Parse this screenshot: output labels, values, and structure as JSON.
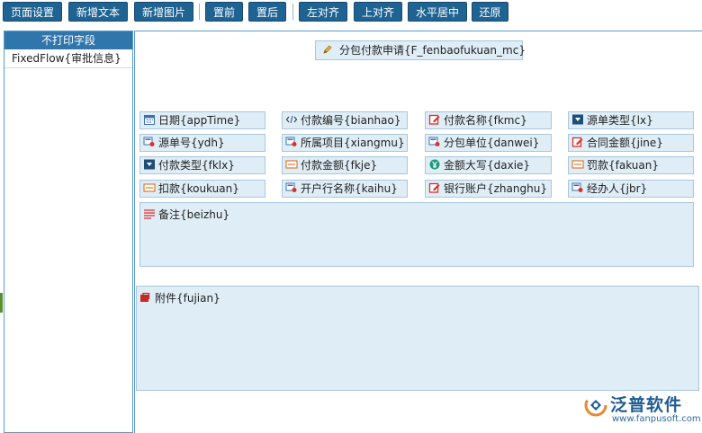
{
  "toolbar": {
    "page_setup": "页面设置",
    "add_text": "新增文本",
    "add_image": "新增图片",
    "bring_front": "置前",
    "send_back": "置后",
    "align_left": "左对齐",
    "align_top": "上对齐",
    "center_horizontal": "水平居中",
    "restore": "还原"
  },
  "left_panel": {
    "header": "不打印字段",
    "items": [
      "FixedFlow{审批信息}"
    ]
  },
  "canvas": {
    "title_field": "分包付款申请{F_fenbaofukuan_mc}",
    "fields": [
      {
        "label": "日期{appTime}",
        "icon": "calendar-icon"
      },
      {
        "label": "付款编号{bianhao}",
        "icon": "code-icon"
      },
      {
        "label": "付款名称{fkmc}",
        "icon": "edit-icon"
      },
      {
        "label": "源单类型{lx}",
        "icon": "dropdown-icon"
      },
      {
        "label": "源单号{ydh}",
        "icon": "lookup-icon"
      },
      {
        "label": "所属项目{xiangmu}",
        "icon": "lookup-icon"
      },
      {
        "label": "分包单位{danwei}",
        "icon": "lookup-icon"
      },
      {
        "label": "合同金额{jine}",
        "icon": "edit-icon"
      },
      {
        "label": "付款类型{fklx}",
        "icon": "dropdown-icon"
      },
      {
        "label": "付款金额{fkje}",
        "icon": "textbox-icon"
      },
      {
        "label": "金额大写{daxie}",
        "icon": "currency-icon"
      },
      {
        "label": "罚款{fakuan}",
        "icon": "textbox-icon"
      },
      {
        "label": "扣款{koukuan}",
        "icon": "textbox-icon"
      },
      {
        "label": "开户行名称{kaihu}",
        "icon": "lookup-icon"
      },
      {
        "label": "银行账户{zhanghu}",
        "icon": "edit-icon"
      },
      {
        "label": "经办人{jbr}",
        "icon": "lookup-icon"
      }
    ],
    "remark_field": "备注{beizhu}",
    "attachment_field": "附件{fujian}"
  },
  "logo": {
    "name": "泛普软件",
    "url": "www.fanpusoft.com"
  },
  "colors": {
    "toolbar_button": "#1f6392",
    "panel_header": "#2f76ac",
    "field_bg": "#dfedf6",
    "field_border": "#a9c7dc",
    "logo_blue": "#1f5c92",
    "icon_red": "#d9302c",
    "icon_blue": "#3b6fb6"
  }
}
